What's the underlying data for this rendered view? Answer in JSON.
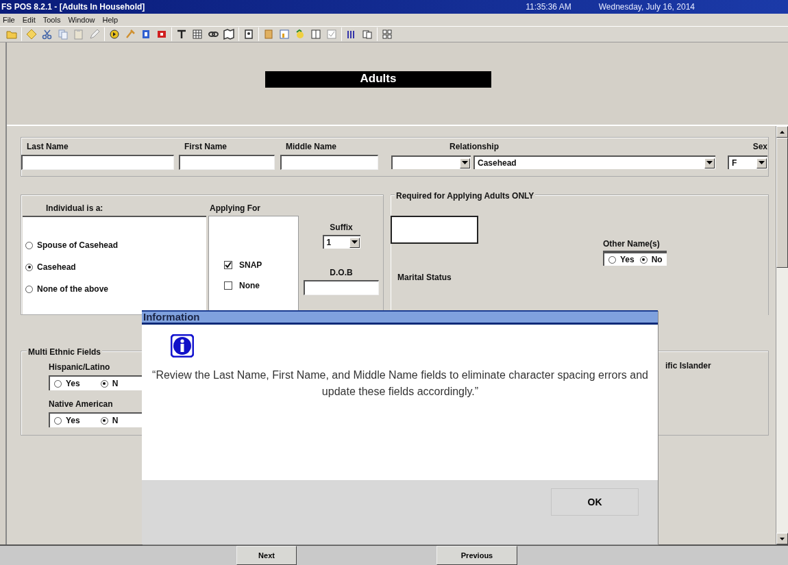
{
  "window": {
    "title": "FS POS 8.2.1 - [Adults In Household]",
    "time": "11:35:36 AM",
    "date": "Wednesday, July 16, 2014"
  },
  "menu": [
    "File",
    "Edit",
    "Tools",
    "Window",
    "Help"
  ],
  "page_title": "Adults",
  "name_fields": [
    {
      "label": "Last Name"
    },
    {
      "label": "First Name"
    },
    {
      "label": "Middle Name"
    }
  ],
  "relationship": {
    "label": "Relationship",
    "value": "Casehead"
  },
  "sex": {
    "label": "Sex",
    "value": "F"
  },
  "individual": {
    "title": "Individual is a:",
    "options": [
      {
        "label": "Spouse of Casehead",
        "selected": false
      },
      {
        "label": "Casehead",
        "selected": true
      },
      {
        "label": "None of the above",
        "selected": false
      }
    ]
  },
  "applying_for": {
    "title": "Applying For",
    "options": [
      {
        "label": "SNAP",
        "checked": true
      },
      {
        "label": "None",
        "checked": false
      }
    ]
  },
  "suffix": {
    "label": "Suffix",
    "value": "1"
  },
  "dob": {
    "label": "D.O.B"
  },
  "required": {
    "title": "Required for Applying Adults ONLY",
    "marital_status": "Marital Status",
    "other_names": {
      "label": "Other Name(s)",
      "options": [
        {
          "label": "Yes",
          "selected": false
        },
        {
          "label": "No",
          "selected": true
        }
      ]
    }
  },
  "ethnic": {
    "title": "Multi Ethnic Fields",
    "questions": [
      {
        "label": "Hispanic/Latino",
        "options": [
          {
            "label": "Yes",
            "selected": false
          },
          {
            "label": "N",
            "selected": true
          }
        ]
      },
      {
        "label": "Native American",
        "options": [
          {
            "label": "Yes",
            "selected": false
          },
          {
            "label": "N",
            "selected": true
          }
        ]
      }
    ],
    "column_2_label": "ific Islander"
  },
  "dialog": {
    "title": "Information",
    "message": "“Review the Last Name, First Name, and Middle Name fields to eliminate character spacing errors and update these fields accordingly.”",
    "button": "OK"
  },
  "nav_buttons": [
    "Next",
    "Previous"
  ]
}
